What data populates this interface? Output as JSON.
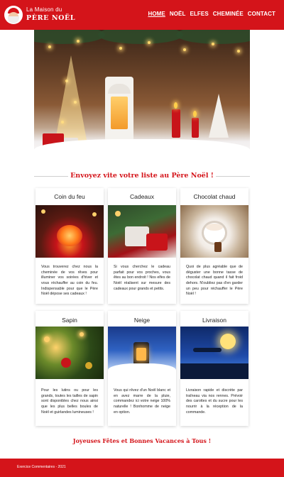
{
  "header": {
    "brand_line1": "La Maison du",
    "brand_line2": "PÈRE NOËL",
    "nav": [
      {
        "label": "HOME",
        "active": true
      },
      {
        "label": "NOËL",
        "active": false
      },
      {
        "label": "ELFES",
        "active": false
      },
      {
        "label": "CHEMINÉE",
        "active": false
      },
      {
        "label": "CONTACT",
        "active": false
      }
    ]
  },
  "section_title": "Envoyez vite votre liste au Père Noël !",
  "cards": [
    {
      "title": "Coin du feu",
      "icon": "fireplace-image",
      "text": "Vous trouverez chez nous la cheminée de vos rêves pour illuminer vos soirées d'hiver et vous réchauffer au coin du feu. Indispensable pour que le Père Noël dépose ses cadeaux !"
    },
    {
      "title": "Cadeaux",
      "icon": "gifts-image",
      "text": "Si vous cherchez le cadeau parfait pour vos proches, vous êtes au bon endroit ! Nos elfes de Noël réalisent sur mesure des cadeaux pour grands et petits."
    },
    {
      "title": "Chocolat chaud",
      "icon": "hot-chocolate-image",
      "text": "Quoi de plus agréable que de déguster une bonne tasse de chocolat chaud quand il fait froid dehors. N'oubliez pas d'en garder un peu pour réchauffer le Père Noël !"
    },
    {
      "title": "Sapin",
      "icon": "christmas-tree-image",
      "text": "Pour les lutins ou pour les grands, toutes les tailles de sapin sont disponibles chez nous ainsi que les plus belles boules de Noël et guirlandes lumineuses !"
    },
    {
      "title": "Neige",
      "icon": "snow-image",
      "text": "Vous qui rêvez d'un Noël blanc et en avez marre de la pluie, commandez ici votre neige 100% naturelle ! Bonhomme de neige en option."
    },
    {
      "title": "Livraison",
      "icon": "sleigh-delivery-image",
      "text": "Livraison rapide et discrète par traîneau via nos rennes. Prévoir des carottes et du sucre pour les nourrir à la réception de la commande."
    }
  ],
  "closing": "Joyeuses Fêtes et Bonnes Vacances à Tous !",
  "footer": "Exercice Commentaires - 2021",
  "colors": {
    "primary": "#d4141a",
    "background": "#ffffff",
    "text": "#222222"
  }
}
